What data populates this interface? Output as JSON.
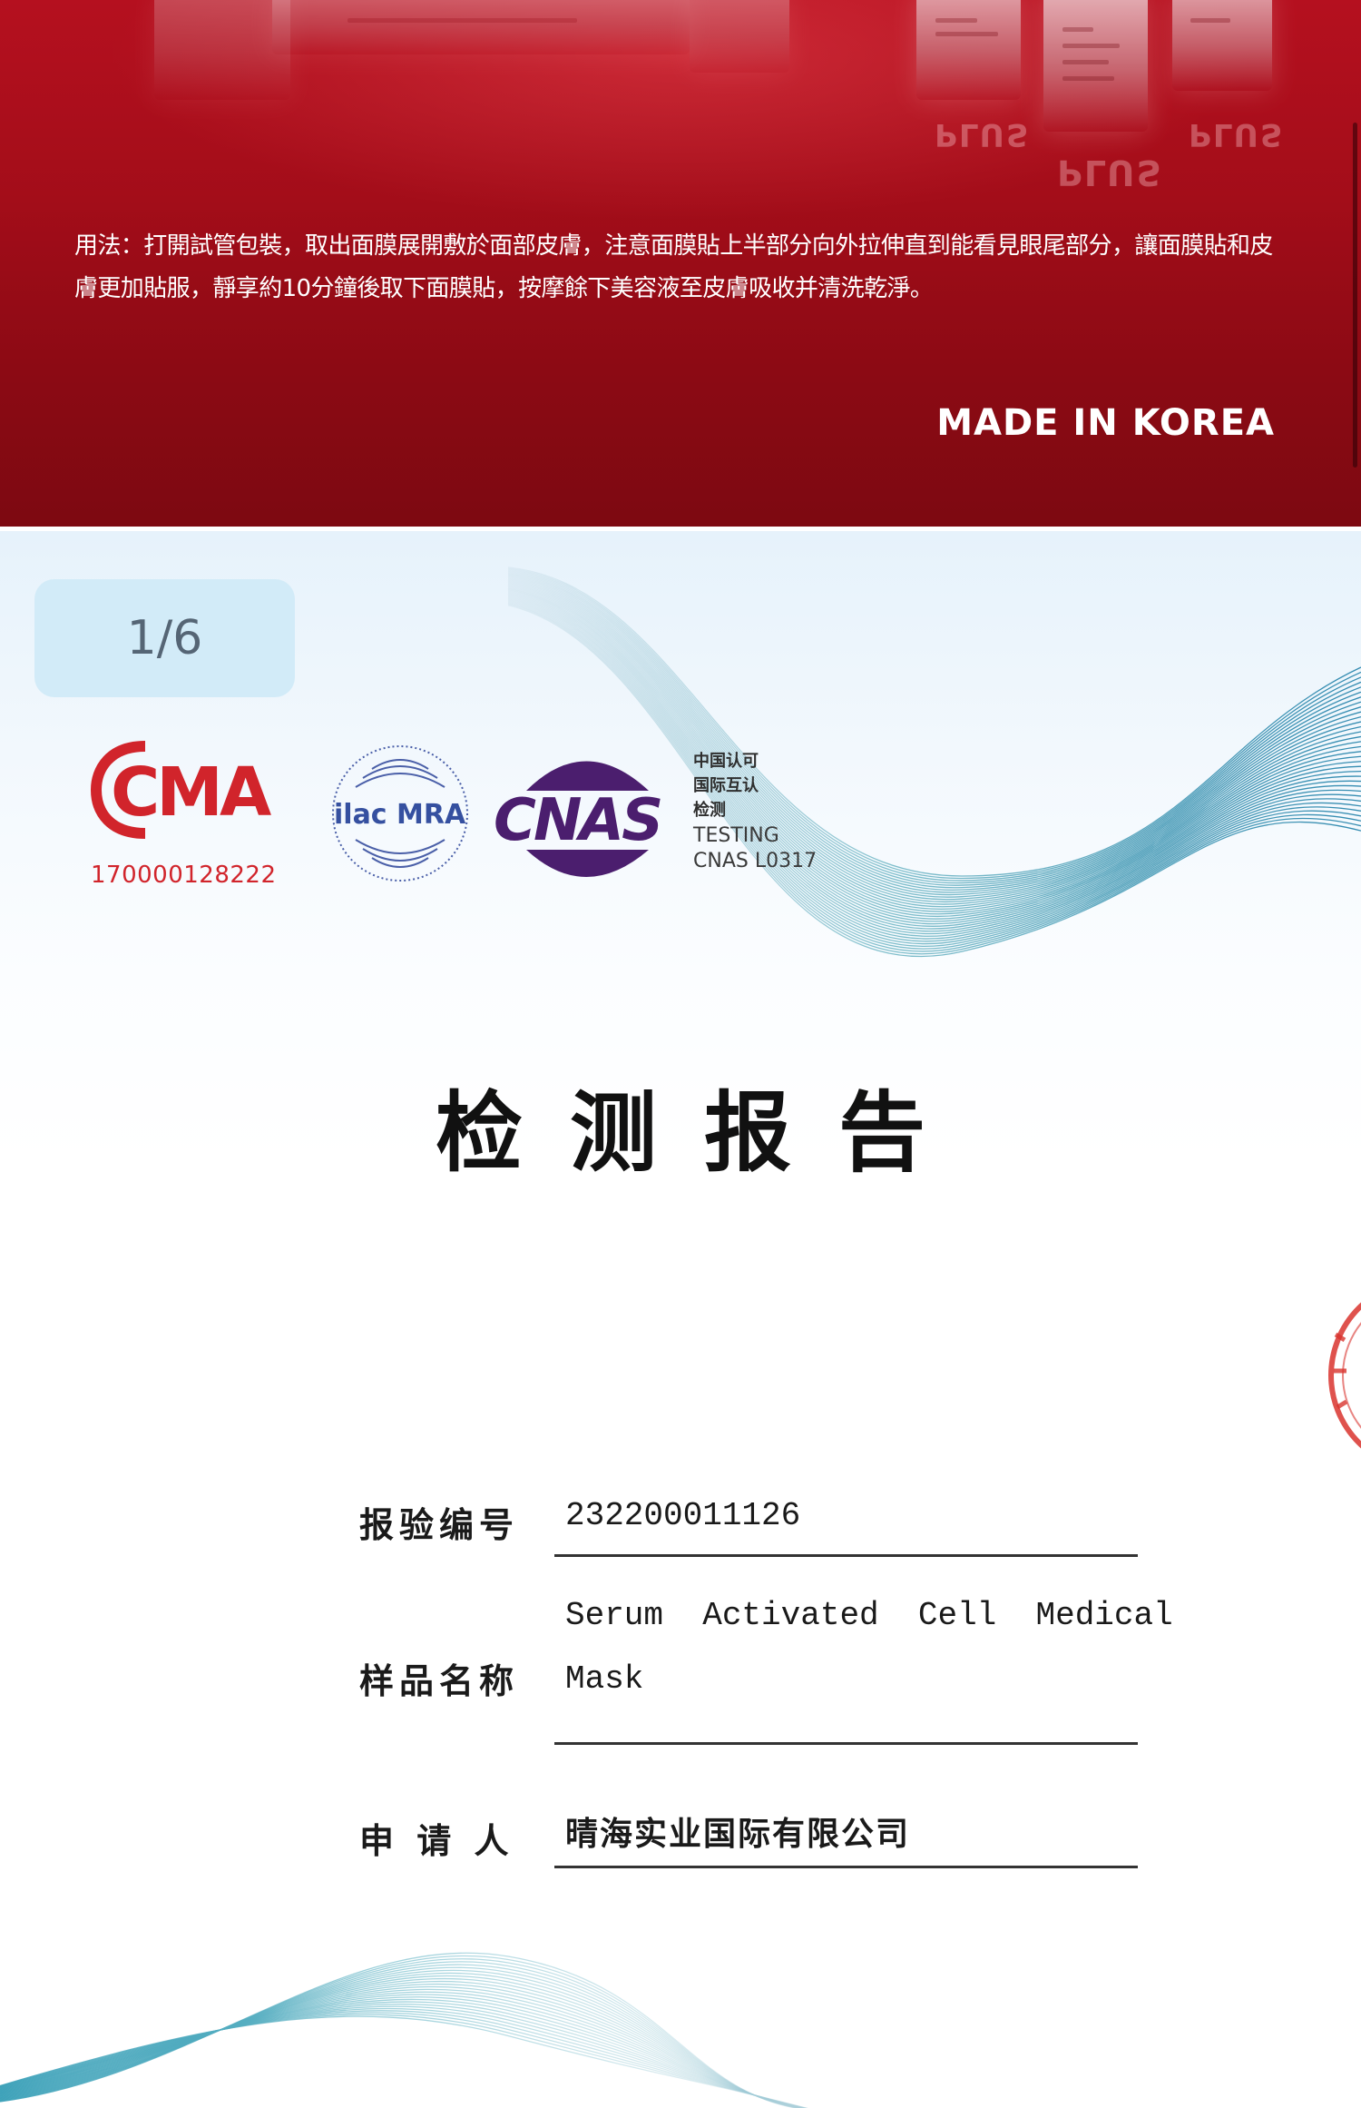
{
  "banner": {
    "usage_text": "用法：打開試管包裝，取出面膜展開敷於面部皮膚，注意面膜貼上半部分向外拉伸直到能看見眼尾部分，讓面膜貼和皮膚更加貼服，靜享約10分鐘後取下面膜貼，按摩餘下美容液至皮膚吸收并清洗乾淨。",
    "made_in": "MADE IN KOREA",
    "reflection_text": "PLUS",
    "colors": {
      "background": "#a30d19",
      "text": "#ffffff"
    }
  },
  "viewer": {
    "page_counter": "1/6"
  },
  "certifications": {
    "cma_mark": "CMA",
    "cma_number": "170000128222",
    "ilac_mark": "ilac MRA",
    "cnas_mark": "CNAS",
    "cnas_cn_lines": [
      "中国认可",
      "国际互认",
      "检测"
    ],
    "cnas_en_lines": [
      "TESTING",
      "CNAS L0317"
    ],
    "colors": {
      "cma_red": "#d1242b",
      "cnas_purple": "#4b1e6e"
    }
  },
  "report": {
    "title": "检测报告",
    "fields": [
      {
        "label": "报验编号",
        "value": "232200011126"
      },
      {
        "label": "样品名称",
        "value_lines": [
          "Serum  Activated  Cell  Medical",
          "Mask"
        ]
      },
      {
        "label": "申 请 人",
        "value": "晴海实业国际有限公司"
      }
    ]
  },
  "icons": {
    "seal": "seal-stamp-icon",
    "waves": "wave-lines-decoration"
  }
}
